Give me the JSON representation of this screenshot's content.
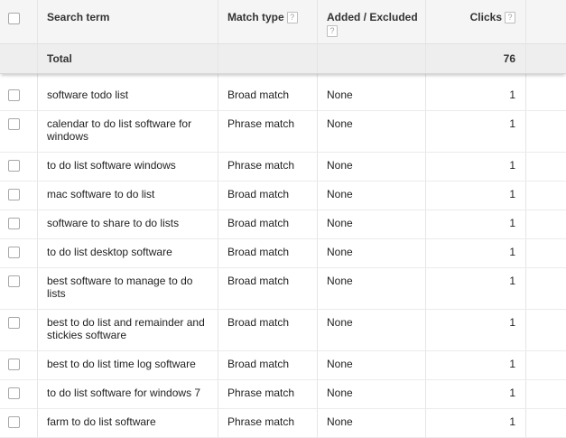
{
  "header": {
    "search_term": "Search term",
    "match_type": "Match type",
    "added_excluded": "Added / Excluded",
    "clicks": "Clicks",
    "help_glyph": "?"
  },
  "total": {
    "label": "Total",
    "clicks": "76"
  },
  "rows": [
    {
      "term": "software todo list",
      "match": "Broad match",
      "added": "None",
      "clicks": "1"
    },
    {
      "term": "calendar to do list software for windows",
      "match": "Phrase match",
      "added": "None",
      "clicks": "1"
    },
    {
      "term": "to do list software windows",
      "match": "Phrase match",
      "added": "None",
      "clicks": "1"
    },
    {
      "term": "mac software to do list",
      "match": "Broad match",
      "added": "None",
      "clicks": "1"
    },
    {
      "term": "software to share to do lists",
      "match": "Broad match",
      "added": "None",
      "clicks": "1"
    },
    {
      "term": "to do list desktop software",
      "match": "Broad match",
      "added": "None",
      "clicks": "1"
    },
    {
      "term": "best software to manage to do lists",
      "match": "Broad match",
      "added": "None",
      "clicks": "1"
    },
    {
      "term": "best to do list and remainder and stickies software",
      "match": "Broad match",
      "added": "None",
      "clicks": "1"
    },
    {
      "term": "best to do list time log software",
      "match": "Broad match",
      "added": "None",
      "clicks": "1"
    },
    {
      "term": "to do list software for windows 7",
      "match": "Phrase match",
      "added": "None",
      "clicks": "1"
    },
    {
      "term": "farm to do list software",
      "match": "Phrase match",
      "added": "None",
      "clicks": "1"
    }
  ],
  "colors": {
    "header_bg": "#f5f5f5",
    "total_bg": "#eeeeee",
    "border": "#e5e5e5",
    "text": "#222222"
  }
}
